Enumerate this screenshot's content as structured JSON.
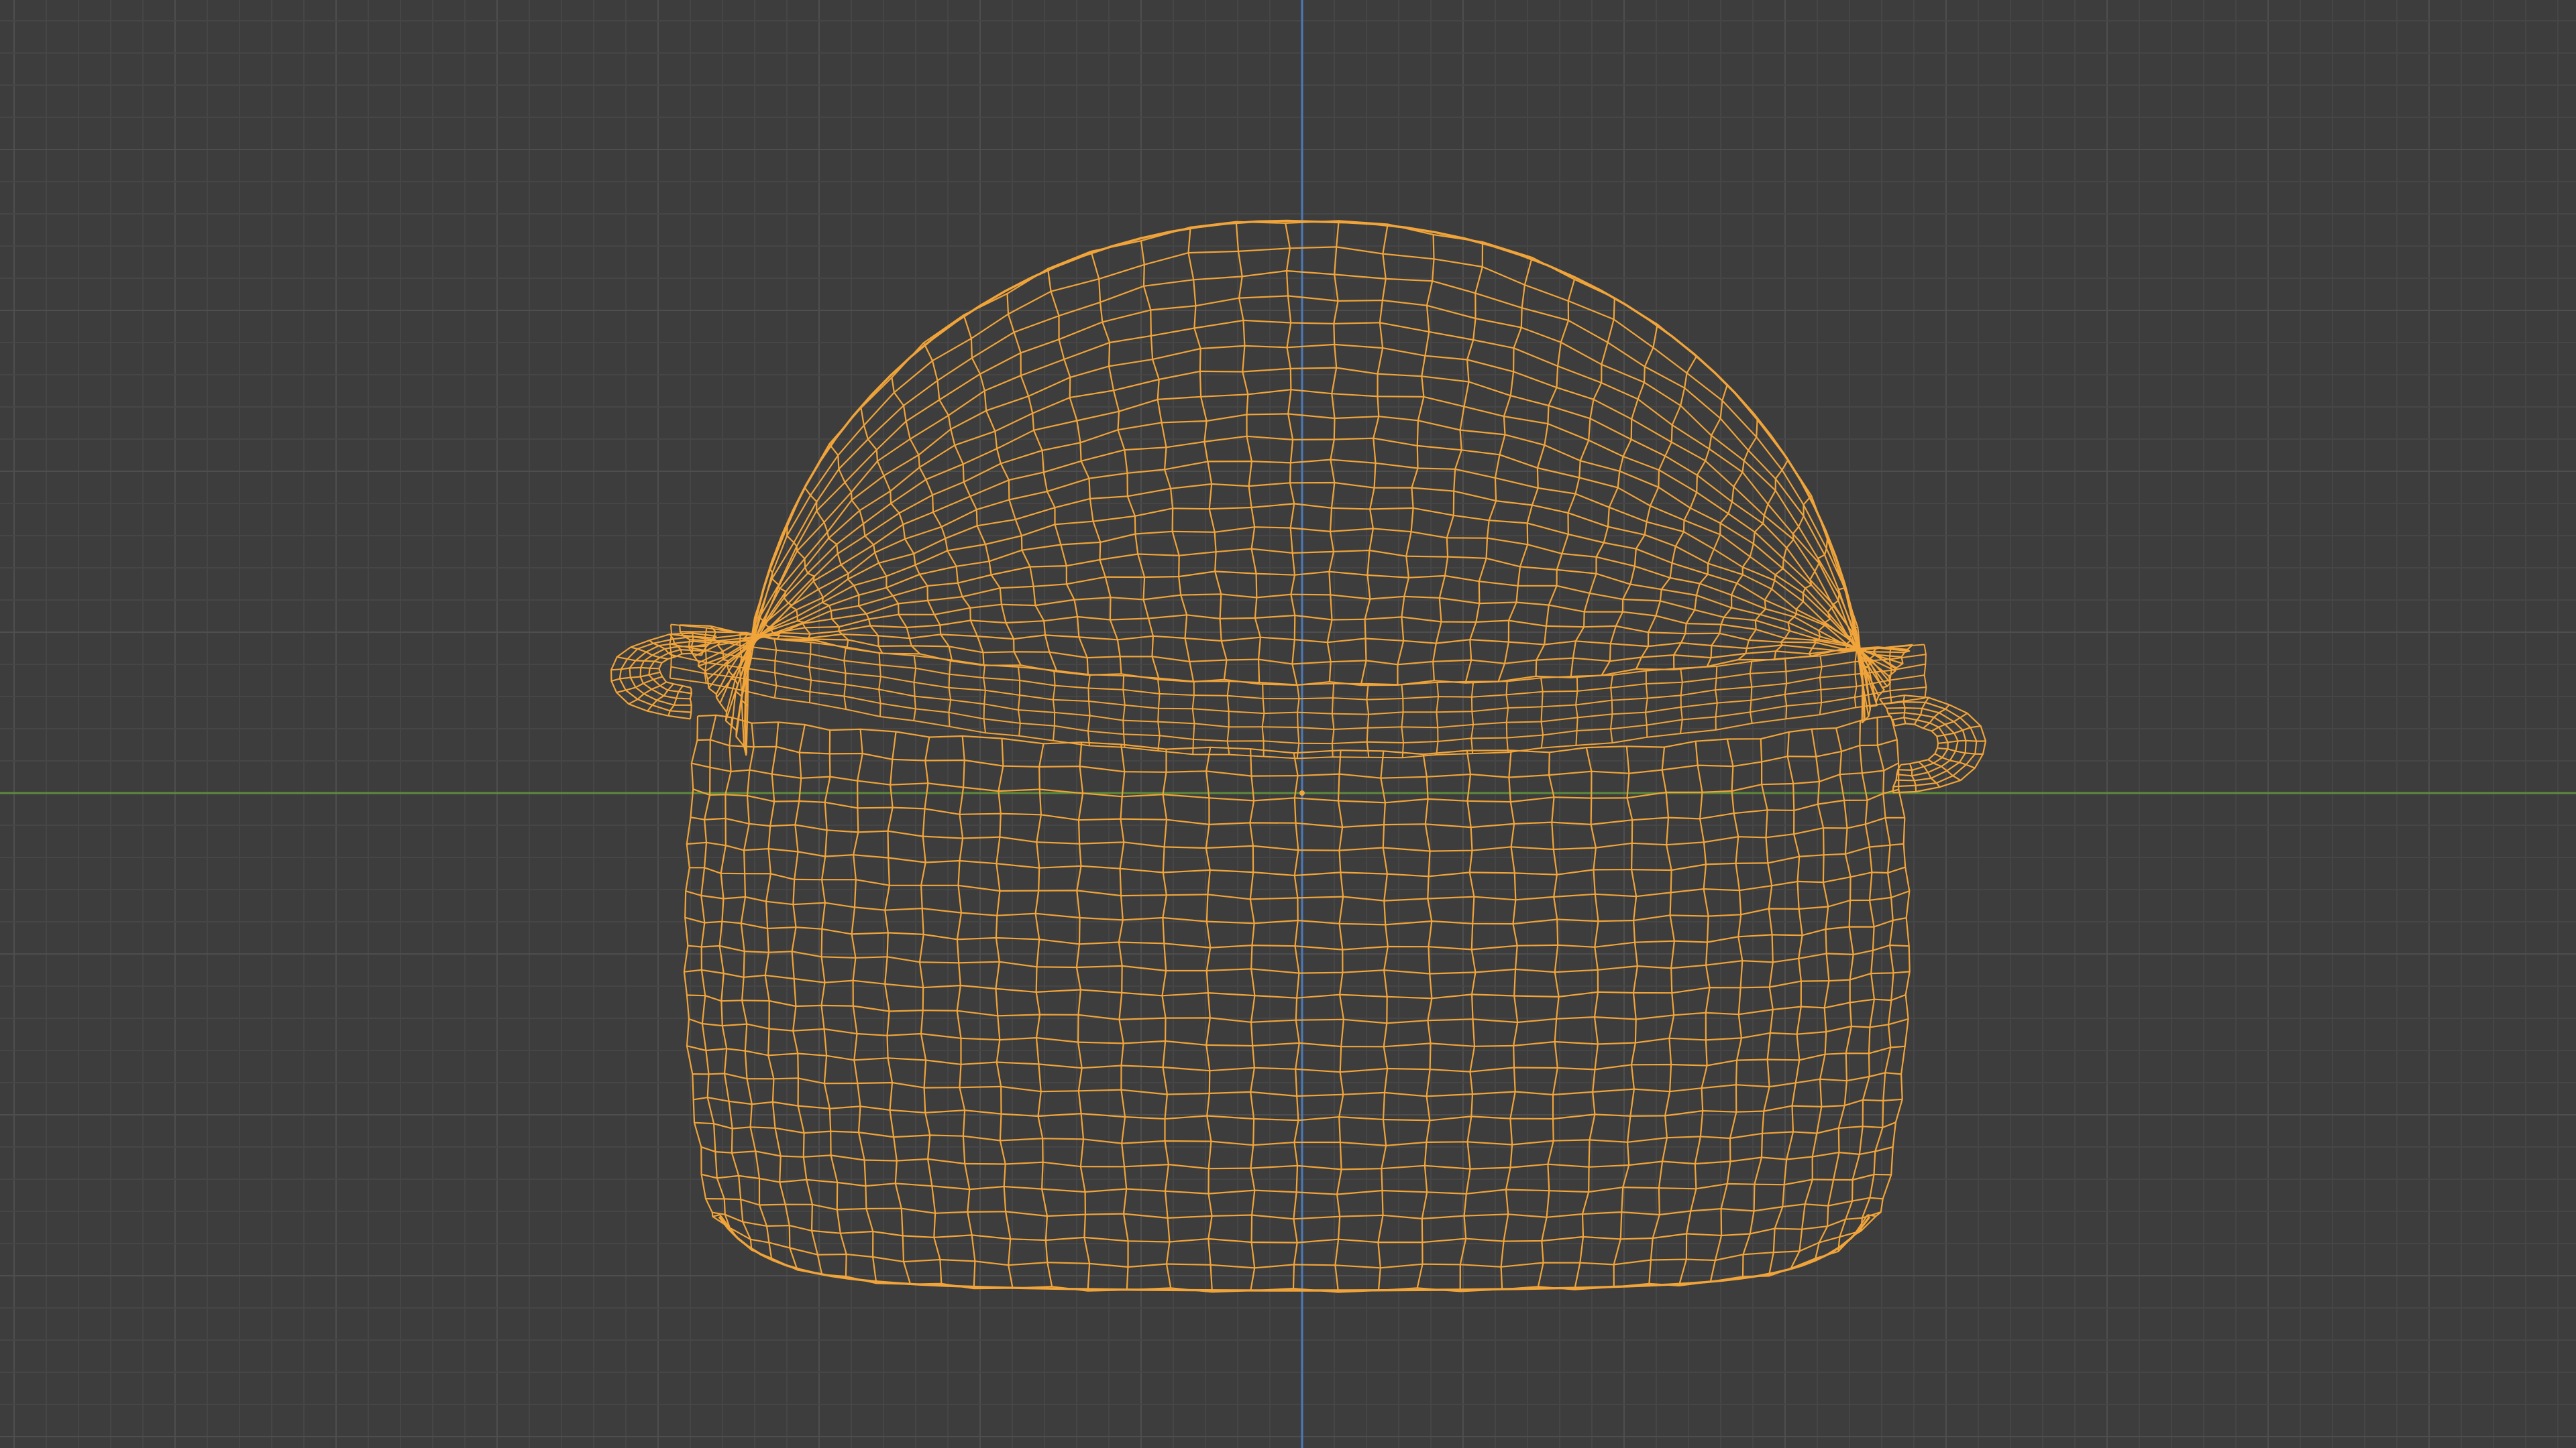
{
  "viewport": {
    "mode": "wireframe",
    "view": "front-orthographic",
    "object": "cap-mesh"
  },
  "colors": {
    "background": "#3d3d3d",
    "grid_minor": "#464646",
    "grid_major": "#4e4e4e",
    "axis_x": "#5d8a3c",
    "axis_z": "#4a7ab8",
    "wire": "#f0a43a",
    "origin": "#f0a43a"
  }
}
